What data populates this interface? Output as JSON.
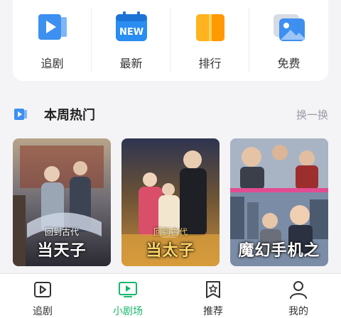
{
  "quick_nav": [
    {
      "label": "追剧",
      "icon": "video-play-icon"
    },
    {
      "label": "最新",
      "icon": "new-badge-icon"
    },
    {
      "label": "排行",
      "icon": "ranking-icon"
    },
    {
      "label": "免费",
      "icon": "free-picture-icon"
    }
  ],
  "section": {
    "title": "本周热门",
    "refresh_label": "换一换"
  },
  "posters": [
    {
      "subtitle": "回到古代",
      "title": "当天子"
    },
    {
      "subtitle": "回到古代",
      "title": "当太子"
    },
    {
      "subtitle": "",
      "title": "魔幻手机之"
    }
  ],
  "tabbar": [
    {
      "label": "追剧",
      "icon": "play-box-icon",
      "active": false
    },
    {
      "label": "小剧场",
      "icon": "tv-play-icon",
      "active": true
    },
    {
      "label": "推荐",
      "icon": "star-bookmark-icon",
      "active": false
    },
    {
      "label": "我的",
      "icon": "user-icon",
      "active": false
    }
  ],
  "colors": {
    "accent": "#16b76a",
    "icon_blue": "#3d8ff0",
    "icon_orange": "#ffaa1a"
  }
}
